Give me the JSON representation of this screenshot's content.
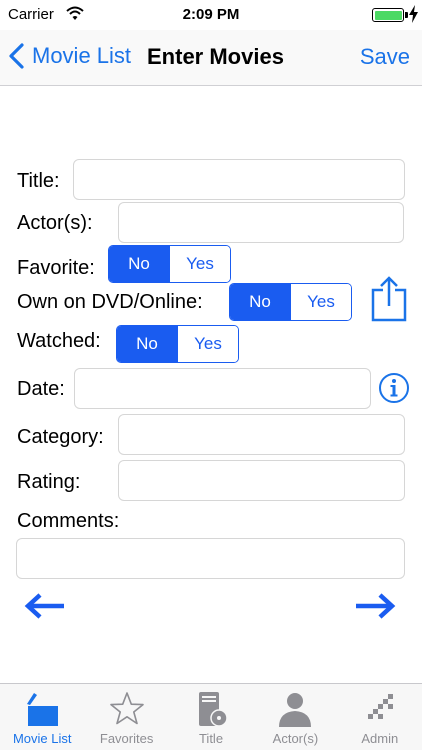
{
  "status_bar": {
    "carrier": "Carrier",
    "time": "2:09 PM"
  },
  "nav": {
    "back_label": "Movie List",
    "title": "Enter Movies",
    "save_label": "Save"
  },
  "form": {
    "title_label": "Title:",
    "title_value": "",
    "actors_label": "Actor(s):",
    "actors_value": "",
    "favorite_label": "Favorite:",
    "favorite_options": [
      "No",
      "Yes"
    ],
    "favorite_selected": "No",
    "own_label": "Own on DVD/Online:",
    "own_options": [
      "No",
      "Yes"
    ],
    "own_selected": "No",
    "watched_label": "Watched:",
    "watched_options": [
      "No",
      "Yes"
    ],
    "watched_selected": "No",
    "date_label": "Date:",
    "date_value": "",
    "category_label": "Category:",
    "category_value": "",
    "rating_label": "Rating:",
    "rating_value": "",
    "comments_label": "Comments:",
    "comments_value": ""
  },
  "tabs": [
    {
      "label": "Movie List",
      "icon": "clapperboard-icon",
      "active": true
    },
    {
      "label": "Favorites",
      "icon": "star-icon",
      "active": false
    },
    {
      "label": "Title",
      "icon": "film-reel-icon",
      "active": false
    },
    {
      "label": "Actor(s)",
      "icon": "person-icon",
      "active": false
    },
    {
      "label": "Admin",
      "icon": "admin-icon",
      "active": false
    }
  ],
  "colors": {
    "accent": "#1a73e8",
    "segment": "#1a5cf0",
    "battery": "#4cd964",
    "tab_inactive": "#8e8e93"
  }
}
